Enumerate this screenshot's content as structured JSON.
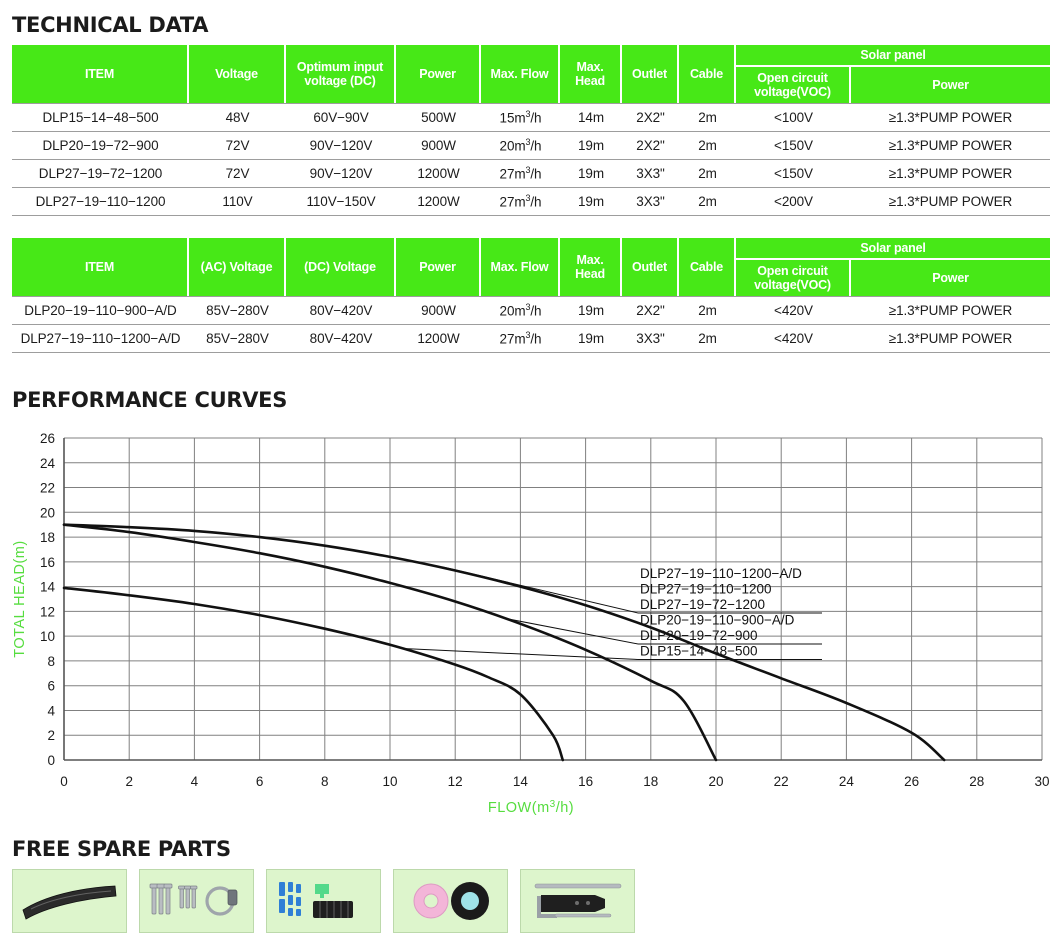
{
  "sections": {
    "technical_data_title": "TECHNICAL DATA",
    "performance_curves_title": "PERFORMANCE CURVES",
    "free_spare_parts_title": "FREE SPARE PARTS"
  },
  "colors": {
    "header_green": "#47E817",
    "axis_label_green": "#56DD3F",
    "part_box_bg": "#ddf5cc",
    "row_rule": "#9d9d9d",
    "curve_black": "#111111"
  },
  "table_dc": {
    "headers": {
      "item": "ITEM",
      "voltage": "Voltage",
      "optimum_input_voltage": "Optimum input voltage (DC)",
      "power": "Power",
      "max_flow": "Max. Flow",
      "max_head": "Max. Head",
      "outlet": "Outlet",
      "cable": "Cable",
      "solar_panel": "Solar panel",
      "open_circuit_voltage": "Open circuit voltage(VOC)",
      "solar_power": "Power"
    },
    "rows": [
      {
        "item": "DLP15−14−48−500",
        "voltage": "48V",
        "optimum": "60V−90V",
        "power": "500W",
        "max_flow": "15",
        "max_flow_unit": "m3/h",
        "max_head": "14m",
        "outlet": "2X2\"",
        "cable": "2m",
        "voc": "<100V",
        "solar_power": "≥1.3*PUMP POWER"
      },
      {
        "item": "DLP20−19−72−900",
        "voltage": "72V",
        "optimum": "90V−120V",
        "power": "900W",
        "max_flow": "20",
        "max_flow_unit": "m3/h",
        "max_head": "19m",
        "outlet": "2X2\"",
        "cable": "2m",
        "voc": "<150V",
        "solar_power": "≥1.3*PUMP POWER"
      },
      {
        "item": "DLP27−19−72−1200",
        "voltage": "72V",
        "optimum": "90V−120V",
        "power": "1200W",
        "max_flow": "27",
        "max_flow_unit": "m3/h",
        "max_head": "19m",
        "outlet": "3X3\"",
        "cable": "2m",
        "voc": "<150V",
        "solar_power": "≥1.3*PUMP POWER"
      },
      {
        "item": "DLP27−19−110−1200",
        "voltage": "110V",
        "optimum": "110V−150V",
        "power": "1200W",
        "max_flow": "27",
        "max_flow_unit": "m3/h",
        "max_head": "19m",
        "outlet": "3X3\"",
        "cable": "2m",
        "voc": "<200V",
        "solar_power": "≥1.3*PUMP POWER"
      }
    ]
  },
  "table_acdc": {
    "headers": {
      "item": "ITEM",
      "ac_voltage": "(AC) Voltage",
      "dc_voltage": "(DC) Voltage",
      "power": "Power",
      "max_flow": "Max. Flow",
      "max_head": "Max. Head",
      "outlet": "Outlet",
      "cable": "Cable",
      "solar_panel": "Solar panel",
      "open_circuit_voltage": "Open circuit voltage(VOC)",
      "solar_power": "Power"
    },
    "rows": [
      {
        "item": "DLP20−19−110−900−A/D",
        "ac": "85V−280V",
        "dc": "80V−420V",
        "power": "900W",
        "max_flow": "20",
        "max_flow_unit": "m3/h",
        "max_head": "19m",
        "outlet": "2X2\"",
        "cable": "2m",
        "voc": "<420V",
        "solar_power": "≥1.3*PUMP POWER"
      },
      {
        "item": "DLP27−19−110−1200−A/D",
        "ac": "85V−280V",
        "dc": "80V−420V",
        "power": "1200W",
        "max_flow": "27",
        "max_flow_unit": "m3/h",
        "max_head": "19m",
        "outlet": "3X3\"",
        "cable": "2m",
        "voc": "<420V",
        "solar_power": "≥1.3*PUMP POWER"
      }
    ]
  },
  "chart_data": {
    "type": "line",
    "title": "PERFORMANCE CURVES",
    "xlabel": "FLOW(m3/h)",
    "ylabel": "TOTAL HEAD(m)",
    "xlim": [
      0,
      30
    ],
    "ylim": [
      0,
      26
    ],
    "xticks": [
      0,
      2,
      4,
      6,
      8,
      10,
      12,
      14,
      16,
      18,
      20,
      22,
      24,
      26,
      28,
      30
    ],
    "yticks": [
      0,
      2,
      4,
      6,
      8,
      10,
      12,
      14,
      16,
      18,
      20,
      22,
      24,
      26
    ],
    "grid": true,
    "legend_position": "inside-right",
    "series": [
      {
        "name": "DLP27−19−110−1200−A/D",
        "points": [
          [
            0,
            19.0
          ],
          [
            2,
            18.8
          ],
          [
            4,
            18.5
          ],
          [
            6,
            18.0
          ],
          [
            8,
            17.3
          ],
          [
            10,
            16.4
          ],
          [
            12,
            15.3
          ],
          [
            14,
            14.0
          ],
          [
            16,
            12.5
          ],
          [
            18,
            10.7
          ],
          [
            20,
            8.6
          ],
          [
            22,
            6.6
          ],
          [
            24,
            4.6
          ],
          [
            26,
            2.2
          ],
          [
            27,
            0.0
          ]
        ]
      },
      {
        "name": "DLP27−19−110−1200",
        "points": [
          [
            0,
            19.0
          ],
          [
            2,
            18.8
          ],
          [
            4,
            18.5
          ],
          [
            6,
            18.0
          ],
          [
            8,
            17.3
          ],
          [
            10,
            16.4
          ],
          [
            12,
            15.3
          ],
          [
            14,
            14.0
          ],
          [
            16,
            12.5
          ],
          [
            18,
            10.7
          ],
          [
            20,
            8.6
          ],
          [
            22,
            6.6
          ],
          [
            24,
            4.6
          ],
          [
            26,
            2.2
          ],
          [
            27,
            0.0
          ]
        ]
      },
      {
        "name": "DLP27−19−72−1200",
        "points": [
          [
            0,
            19.0
          ],
          [
            2,
            18.8
          ],
          [
            4,
            18.5
          ],
          [
            6,
            18.0
          ],
          [
            8,
            17.3
          ],
          [
            10,
            16.4
          ],
          [
            12,
            15.3
          ],
          [
            14,
            14.0
          ],
          [
            16,
            12.5
          ],
          [
            18,
            10.7
          ],
          [
            20,
            8.6
          ],
          [
            22,
            6.6
          ],
          [
            24,
            4.6
          ],
          [
            26,
            2.2
          ],
          [
            27,
            0.0
          ]
        ]
      },
      {
        "name": "DLP20−19−110−900−A/D",
        "points": [
          [
            0,
            19.0
          ],
          [
            2,
            18.4
          ],
          [
            4,
            17.6
          ],
          [
            6,
            16.7
          ],
          [
            8,
            15.6
          ],
          [
            10,
            14.3
          ],
          [
            12,
            12.8
          ],
          [
            14,
            11.0
          ],
          [
            16,
            8.9
          ],
          [
            18,
            6.4
          ],
          [
            19,
            4.8
          ],
          [
            20,
            0.0
          ]
        ]
      },
      {
        "name": "DLP20−19−72−900",
        "points": [
          [
            0,
            19.0
          ],
          [
            2,
            18.4
          ],
          [
            4,
            17.6
          ],
          [
            6,
            16.7
          ],
          [
            8,
            15.6
          ],
          [
            10,
            14.3
          ],
          [
            12,
            12.8
          ],
          [
            14,
            11.0
          ],
          [
            16,
            8.9
          ],
          [
            18,
            6.4
          ],
          [
            19,
            4.8
          ],
          [
            20,
            0.0
          ]
        ]
      },
      {
        "name": "DLP15−14−48−500",
        "points": [
          [
            0,
            13.9
          ],
          [
            2,
            13.3
          ],
          [
            4,
            12.6
          ],
          [
            6,
            11.7
          ],
          [
            8,
            10.6
          ],
          [
            10,
            9.3
          ],
          [
            12,
            7.7
          ],
          [
            13,
            6.7
          ],
          [
            14,
            5.3
          ],
          [
            15,
            2.0
          ],
          [
            15.3,
            0.0
          ]
        ]
      }
    ],
    "legend_labels": [
      "DLP27−19−110−1200−A/D",
      "DLP27−19−110−1200",
      "DLP27−19−72−1200",
      "DLP20−19−110−900−A/D",
      "DLP20−19−72−900",
      "DLP15−14−48−500"
    ]
  },
  "spare_parts": {
    "items": [
      {
        "name": "hose-pipe",
        "label": "Hose"
      },
      {
        "name": "screws-and-clamp",
        "label": "Screws & hose clamp"
      },
      {
        "name": "connectors-and-rubber-blocks",
        "label": "Connectors & rubber blocks"
      },
      {
        "name": "tape-rolls",
        "label": "Sealing tape rolls"
      },
      {
        "name": "wrench-and-tool",
        "label": "Wrench & tool"
      }
    ]
  }
}
